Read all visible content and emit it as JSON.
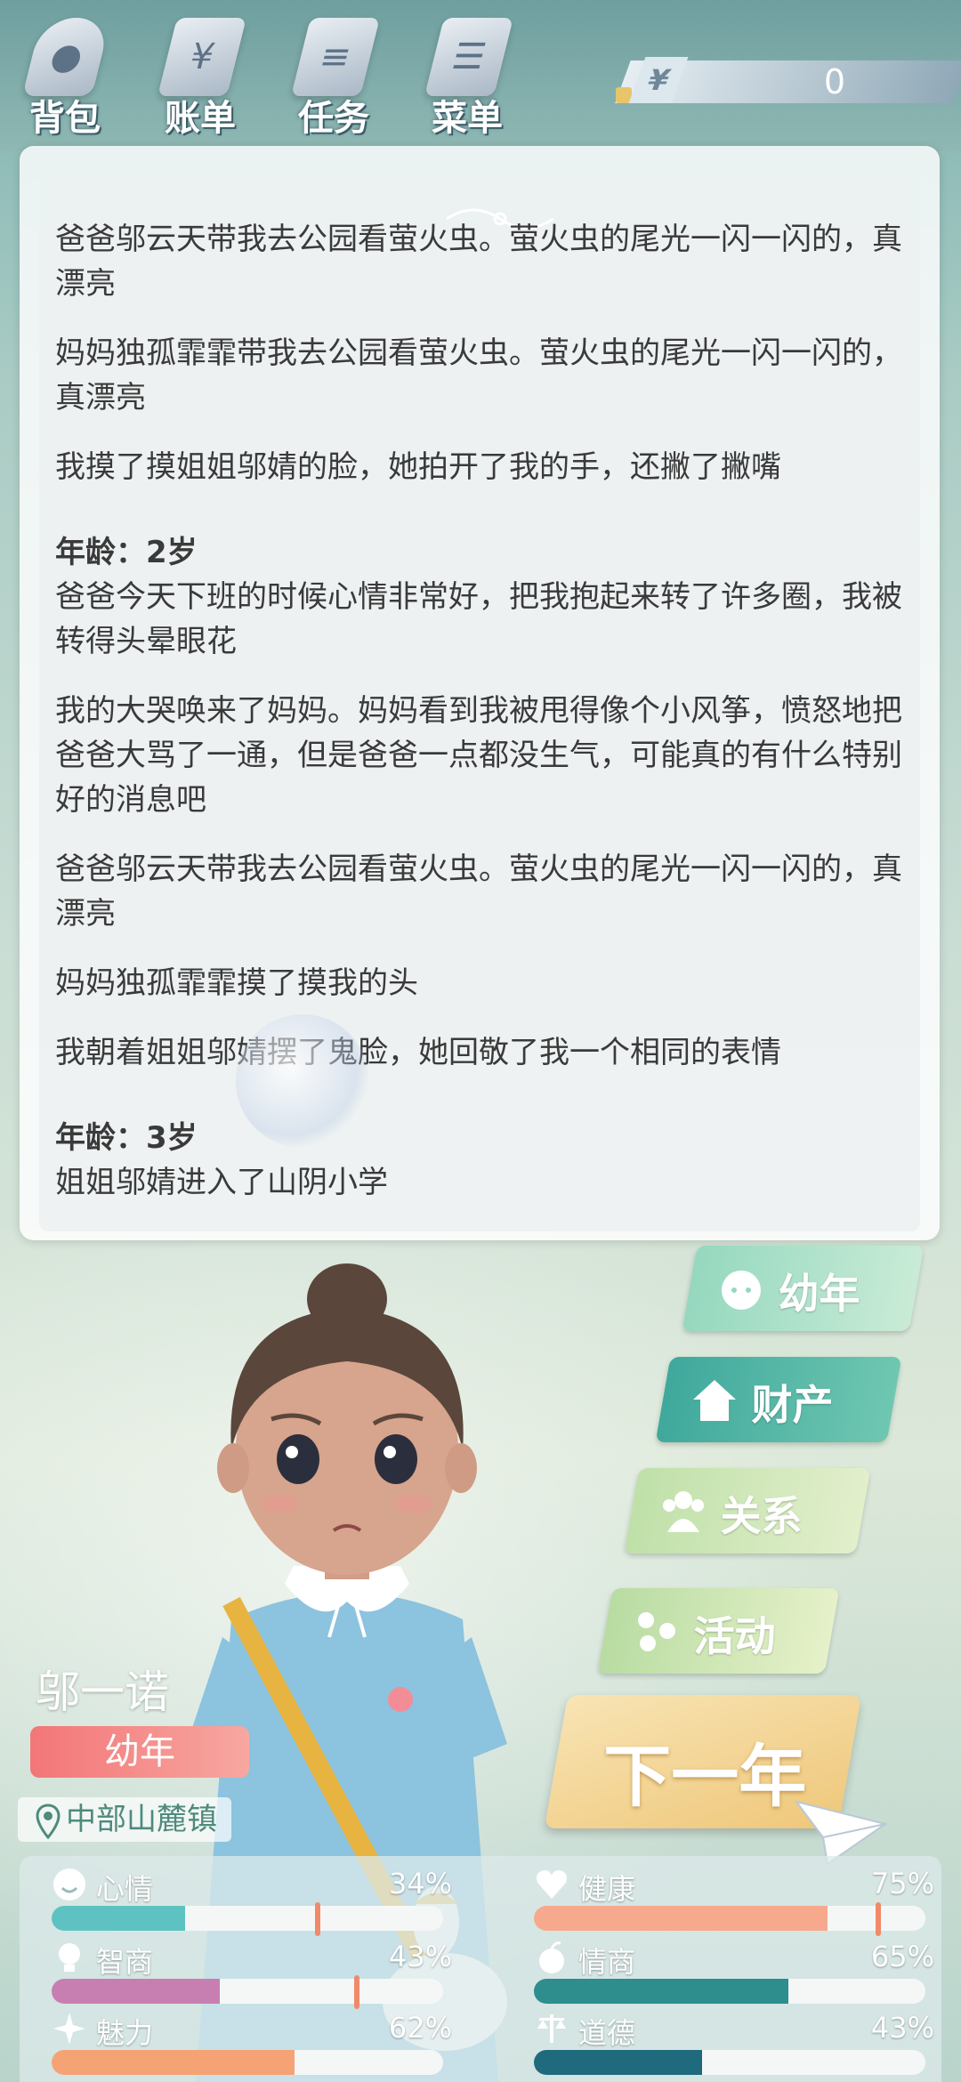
{
  "top_nav": [
    {
      "label": "背包",
      "icon": "bag-icon"
    },
    {
      "label": "账单",
      "icon": "bill-icon"
    },
    {
      "label": "任务",
      "icon": "task-icon"
    },
    {
      "label": "菜单",
      "icon": "menu-icon"
    }
  ],
  "money": {
    "symbol": "¥",
    "value": "0"
  },
  "log": {
    "entries_top": [
      "爸爸邬云天带我去公园看萤火虫。萤火虫的尾光一闪一闪的，真漂亮",
      "妈妈独孤霏霏带我去公园看萤火虫。萤火虫的尾光一闪一闪的，真漂亮",
      "我摸了摸姐姐邬婧的脸，她拍开了我的手，还撇了撇嘴"
    ],
    "age2": "年龄：2岁",
    "entries_age2": [
      "爸爸今天下班的时候心情非常好，把我抱起来转了许多圈，我被转得头晕眼花",
      "我的大哭唤来了妈妈。妈妈看到我被甩得像个小风筝，愤怒地把爸爸大骂了一通，但是爸爸一点都没生气，可能真的有什么特别好的消息吧",
      "爸爸邬云天带我去公园看萤火虫。萤火虫的尾光一闪一闪的，真漂亮",
      "妈妈独孤霏霏摸了摸我的头",
      "我朝着姐姐邬婧摆了鬼脸，她回敬了我一个相同的表情"
    ],
    "age3": "年龄：3岁",
    "entries_age3": [
      "姐姐邬婧进入了山阴小学"
    ]
  },
  "menu": {
    "stage": "幼年",
    "assets": "财产",
    "relations": "关系",
    "activities": "活动",
    "next_year": "下一年"
  },
  "profile": {
    "name": "邬一诺",
    "stage": "幼年",
    "location": "中部山麓镇"
  },
  "stats": [
    {
      "name": "心情",
      "value": "34%",
      "fill": 0.34,
      "color": "#5fc2c2",
      "marker": 0.68
    },
    {
      "name": "健康",
      "value": "75%",
      "fill": 0.75,
      "color": "#f7a98d",
      "marker": 0.88
    },
    {
      "name": "智商",
      "value": "43%",
      "fill": 0.43,
      "color": "#c77fb1",
      "marker": 0.78
    },
    {
      "name": "情商",
      "value": "65%",
      "fill": 0.65,
      "color": "#2e8d8d",
      "marker": null
    },
    {
      "name": "魅力",
      "value": "62%",
      "fill": 0.62,
      "color": "#f5a374",
      "marker": null
    },
    {
      "name": "道德",
      "value": "43%",
      "fill": 0.43,
      "color": "#1f6a7c",
      "marker": null
    }
  ],
  "colors": {
    "accent_menu_top": "#8fd2b9",
    "accent_menu_2": "#52b5a7",
    "accent_next": "#efc77a",
    "stage_badge": "#f37678"
  }
}
